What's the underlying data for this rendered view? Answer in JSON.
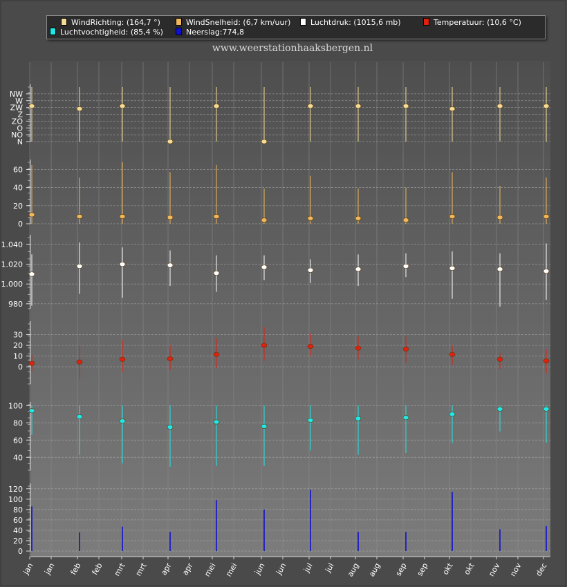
{
  "watermark": "www.weerstationhaaksbergen.nl",
  "legend": [
    {
      "label": "WindRichting: (164,7 °)",
      "color": "#f5dc96"
    },
    {
      "label": "WindSnelheid: (6,7 km/uur)",
      "color": "#f0b85a"
    },
    {
      "label": "Luchtdruk: (1015,6 mb)",
      "color": "#ffffff"
    },
    {
      "label": "Temperatuur: (10,6 °C)",
      "color": "#e02010"
    },
    {
      "label": "Luchtvochtigheid: (85,4 %)",
      "color": "#20e8e8"
    },
    {
      "label": "Neerslag:774,8",
      "color": "#1010d0"
    }
  ],
  "x_labels": [
    "jan",
    "jan",
    "feb",
    "feb",
    "mrt",
    "mrt",
    "apr",
    "apr",
    "mei",
    "mei",
    "jun",
    "jun",
    "jul",
    "jul",
    "aug",
    "aug",
    "sep",
    "sep",
    "okt",
    "okt",
    "nov",
    "nov",
    "dec"
  ],
  "chart_data": [
    {
      "type": "scatter",
      "name": "WindRichting",
      "color": "#f5dc96",
      "categories": [
        "jan",
        "feb",
        "mrt",
        "apr",
        "mei",
        "jun",
        "jul",
        "aug",
        "sep",
        "okt",
        "nov",
        "dec"
      ],
      "y_ticks": [
        "N",
        "NO",
        "O",
        "ZO",
        "Z",
        "ZW",
        "W",
        "NW"
      ],
      "values": [
        5.2,
        4.8,
        5.2,
        0.0,
        5.2,
        0.0,
        5.2,
        5.2,
        5.2,
        4.8,
        5.2,
        5.2
      ],
      "low": [
        0,
        0,
        0,
        0,
        0,
        0,
        0,
        0,
        0,
        0,
        0,
        0
      ],
      "high": [
        8,
        8,
        8,
        8,
        8,
        8,
        8,
        8,
        8,
        8,
        8,
        8
      ],
      "ylim": [
        0,
        8
      ]
    },
    {
      "type": "scatter",
      "name": "WindSnelheid",
      "color": "#f0b85a",
      "categories": [
        "jan",
        "feb",
        "mrt",
        "apr",
        "mei",
        "jun",
        "jul",
        "aug",
        "sep",
        "okt",
        "nov",
        "dec"
      ],
      "y_ticks": [
        "0",
        "20",
        "40",
        "60"
      ],
      "values": [
        10,
        8,
        8,
        7,
        8,
        4,
        6,
        6,
        4,
        8,
        7,
        8
      ],
      "low": [
        0,
        0,
        0,
        0,
        0,
        0,
        0,
        0,
        0,
        0,
        0,
        0
      ],
      "high": [
        65,
        51,
        68,
        57,
        65,
        39,
        53,
        39,
        40,
        57,
        42,
        51
      ],
      "ylim": [
        0,
        68
      ]
    },
    {
      "type": "scatter",
      "name": "Luchtdruk",
      "color": "#ffffff",
      "categories": [
        "jan",
        "feb",
        "mrt",
        "apr",
        "mei",
        "jun",
        "jul",
        "aug",
        "sep",
        "okt",
        "nov",
        "dec"
      ],
      "y_ticks": [
        "980",
        "1.000",
        "1.020",
        "1.040"
      ],
      "values": [
        1010,
        1018,
        1020,
        1019,
        1011,
        1017,
        1014,
        1015,
        1018,
        1016,
        1015,
        1013
      ],
      "low": [
        978,
        990,
        986,
        998,
        992,
        1004,
        1001,
        998,
        1007,
        985,
        977,
        984
      ],
      "high": [
        1030,
        1042,
        1037,
        1034,
        1029,
        1029,
        1025,
        1030,
        1031,
        1033,
        1031,
        1041
      ],
      "ylim": [
        975,
        1047
      ]
    },
    {
      "type": "scatter",
      "name": "Temperatuur",
      "color": "#e02010",
      "categories": [
        "jan",
        "feb",
        "mrt",
        "apr",
        "mei",
        "jun",
        "jul",
        "aug",
        "sep",
        "okt",
        "nov",
        "dec"
      ],
      "y_ticks": [
        "0",
        "10",
        "20",
        "30"
      ],
      "values": [
        3.2,
        4.5,
        7.0,
        7.5,
        11.5,
        20.0,
        19.0,
        17.5,
        16.5,
        11.5,
        7.0,
        5.5
      ],
      "low": [
        -4,
        -12,
        -5,
        -3,
        -1,
        6,
        10,
        7,
        4,
        2,
        -2,
        -6
      ],
      "high": [
        11,
        20,
        25,
        20,
        27,
        37,
        31,
        28,
        28,
        20,
        13,
        16
      ],
      "ylim": [
        -16,
        40
      ]
    },
    {
      "type": "scatter",
      "name": "Luchtvochtigheid",
      "color": "#20e8e8",
      "categories": [
        "jan",
        "feb",
        "mrt",
        "apr",
        "mei",
        "jun",
        "jul",
        "aug",
        "sep",
        "okt",
        "nov",
        "dec"
      ],
      "y_ticks": [
        "40",
        "60",
        "80",
        "100"
      ],
      "values": [
        94,
        87,
        82,
        75,
        81,
        76,
        83,
        85,
        86,
        90,
        96,
        96
      ],
      "low": [
        66,
        43,
        33,
        29,
        30,
        30,
        48,
        43,
        45,
        57,
        70,
        57
      ],
      "high": [
        100,
        100,
        100,
        100,
        100,
        100,
        100,
        100,
        100,
        100,
        100,
        100
      ],
      "ylim": [
        25,
        101
      ]
    },
    {
      "type": "bar",
      "name": "Neerslag",
      "color": "#1010d0",
      "categories": [
        "jan",
        "feb",
        "mrt",
        "apr",
        "mei",
        "jun",
        "jul",
        "aug",
        "sep",
        "okt",
        "nov",
        "dec"
      ],
      "y_ticks": [
        "0",
        "20",
        "40",
        "60",
        "80",
        "100",
        "120"
      ],
      "values": [
        86,
        36,
        47,
        37,
        98,
        80,
        118,
        37,
        37,
        114,
        42,
        48
      ],
      "ylim": [
        0,
        125
      ]
    }
  ]
}
